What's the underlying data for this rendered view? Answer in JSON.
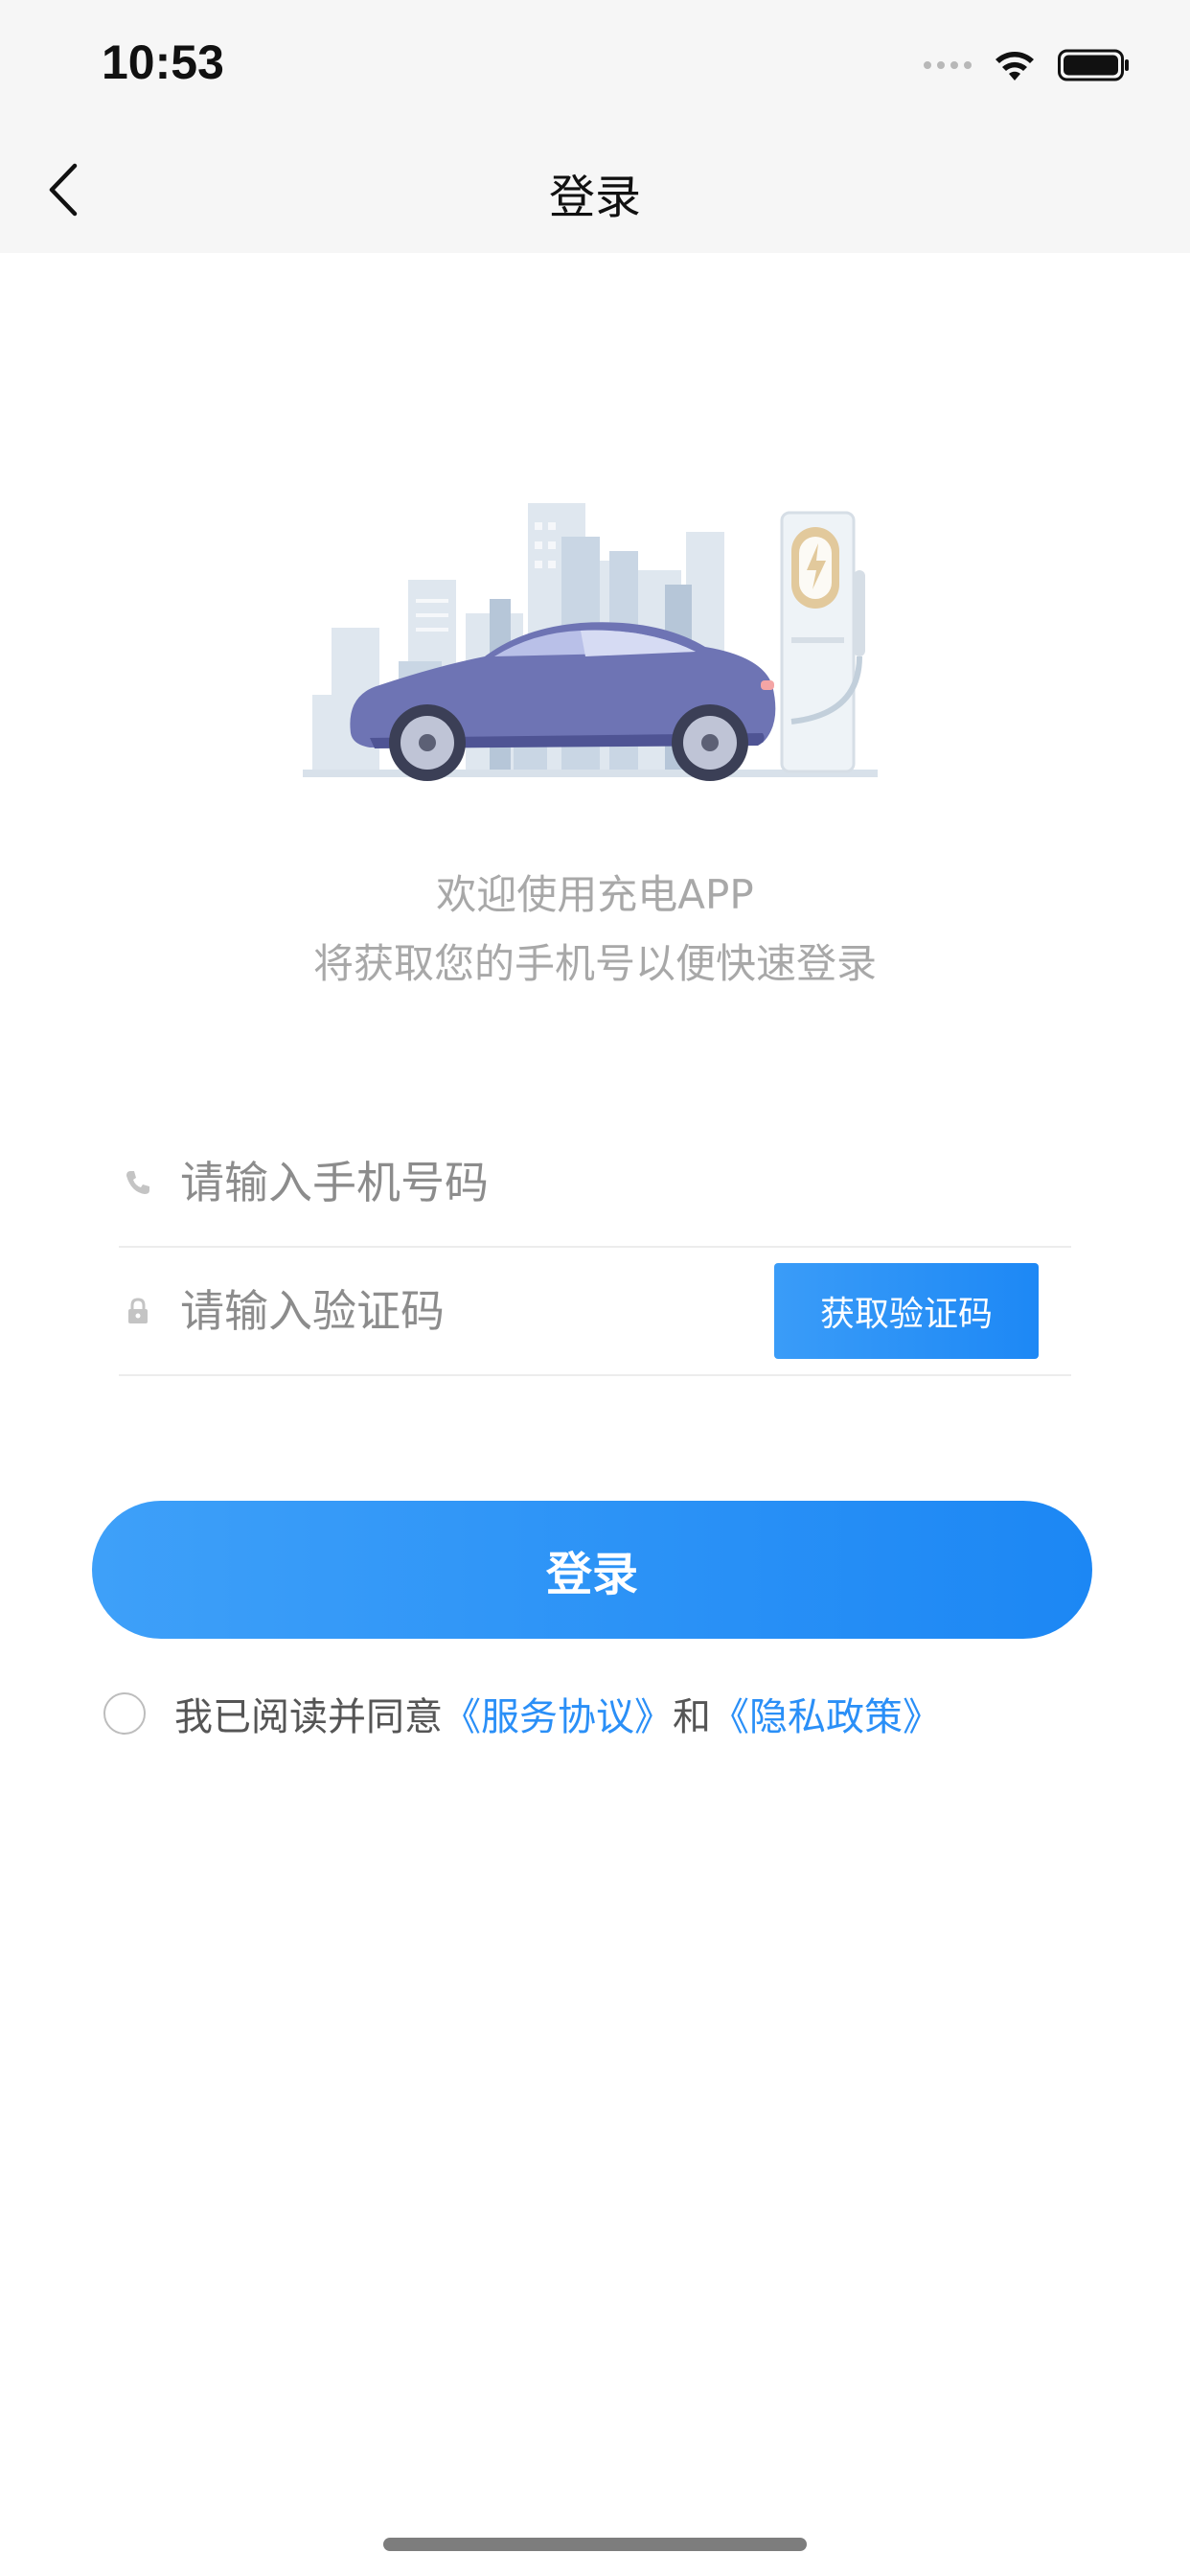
{
  "status_bar": {
    "time": "10:53",
    "icons": [
      "signal-dots-icon",
      "wifi-icon",
      "battery-icon"
    ]
  },
  "nav": {
    "title": "登录",
    "back_icon": "chevron-left-icon"
  },
  "welcome": {
    "line1": "欢迎使用充电APP",
    "line2": "将获取您的手机号以便快速登录"
  },
  "form": {
    "phone_placeholder": "请输入手机号码",
    "code_placeholder": "请输入验证码",
    "get_code_label": "获取验证码"
  },
  "login_label": "登录",
  "agreement": {
    "prefix": "我已阅读并同意",
    "service_link": "《服务协议》",
    "and": "和",
    "privacy_link": "《隐私政策》"
  },
  "colors": {
    "accent": "#2a8ff7",
    "topbar_bg": "#f6f6f6",
    "placeholder": "#8c8c8c"
  }
}
